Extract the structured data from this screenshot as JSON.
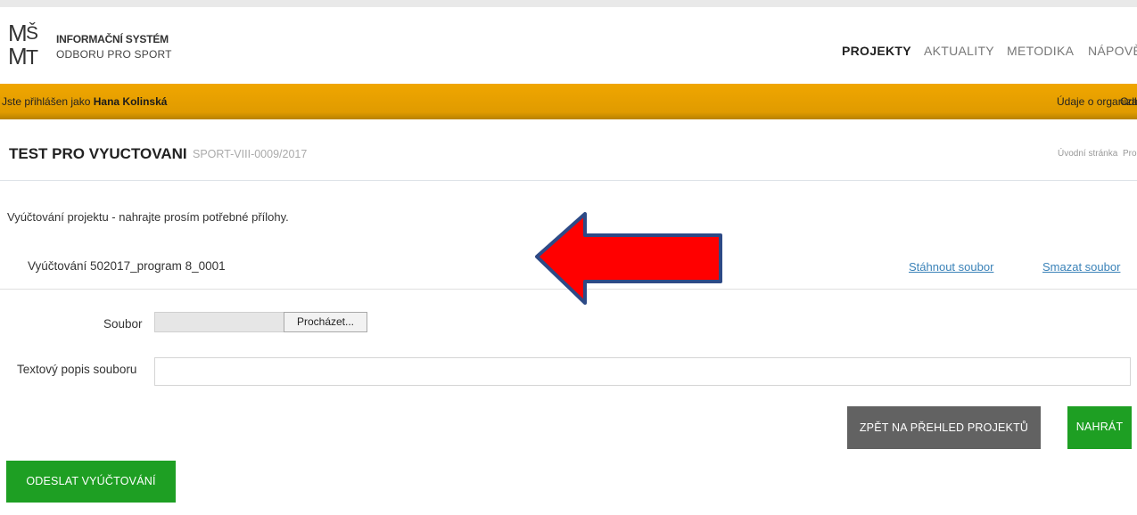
{
  "header": {
    "logo_text": "MŠMT",
    "brand_line1": "INFORMAČNÍ SYSTÉM",
    "brand_line2": "ODBORU PRO SPORT",
    "nav": [
      "PROJEKTY",
      "AKTUALITY",
      "METODIKA",
      "NÁPOVĚ"
    ],
    "active_nav": "PROJEKTY"
  },
  "userbar": {
    "prefix": "Jste přihlášen jako ",
    "user": "Hana Kolinská",
    "org_link": "Údaje o organizaci",
    "logout_link": "Odh"
  },
  "page": {
    "title": "TEST PRO VYUCTOVANI",
    "code": "SPORT-VIII-0009/2017",
    "breadcrumb": [
      "Úvodní stránka",
      "Pro"
    ]
  },
  "main": {
    "intro": "Vyúčtování projektu - nahrajte prosím potřebné přílohy.",
    "file_name": "Vyúčtování 502017_program 8_0001",
    "download_link": "Stáhnout soubor",
    "delete_link": "Smazat soubor",
    "file_label": "Soubor",
    "browse_label": "Procházet...",
    "file_value": "",
    "desc_label": "Textový popis souboru",
    "desc_value": ""
  },
  "buttons": {
    "back": "ZPĚT NA PŘEHLED PROJEKTŮ",
    "upload": "NAHRÁT",
    "send": "ODESLAT VYÚČTOVÁNÍ"
  },
  "colors": {
    "userbar": "#e8a000",
    "green": "#1e9f23",
    "gray_button": "#626262",
    "link": "#3a82b8",
    "arrow": "#ff0000"
  }
}
